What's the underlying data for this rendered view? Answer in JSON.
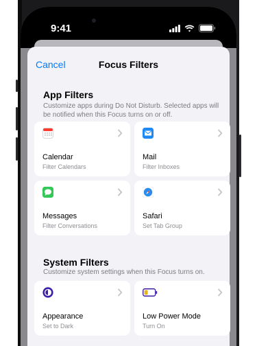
{
  "status_bar": {
    "time": "9:41"
  },
  "nav": {
    "cancel_label": "Cancel",
    "title": "Focus Filters"
  },
  "app_filters": {
    "title": "App Filters",
    "description": "Customize apps during Do Not Disturb. Selected apps will be notified when this Focus turns on or off.",
    "tiles": [
      {
        "title": "Calendar",
        "subtitle": "Filter Calendars",
        "icon": "calendar-icon"
      },
      {
        "title": "Mail",
        "subtitle": "Filter Inboxes",
        "icon": "mail-icon"
      },
      {
        "title": "Messages",
        "subtitle": "Filter Conversations",
        "icon": "messages-icon"
      },
      {
        "title": "Safari",
        "subtitle": "Set Tab Group",
        "icon": "safari-icon"
      }
    ]
  },
  "system_filters": {
    "title": "System Filters",
    "description": "Customize system settings when this Focus turns on.",
    "tiles": [
      {
        "title": "Appearance",
        "subtitle": "Set to Dark",
        "icon": "appearance-icon"
      },
      {
        "title": "Low Power Mode",
        "subtitle": "Turn On",
        "icon": "battery-icon"
      }
    ]
  },
  "colors": {
    "accent": "#007aff",
    "sheet_background": "#f2f2f7",
    "tile_background": "#ffffff",
    "secondary_text": "#8e8e93"
  }
}
